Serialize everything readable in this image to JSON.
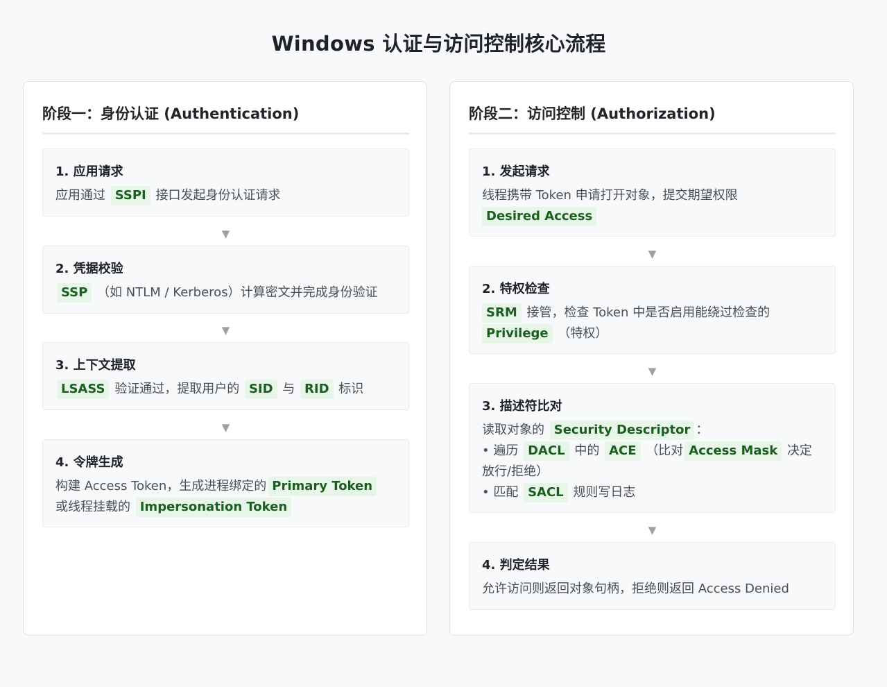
{
  "title": "Windows 认证与访问控制核心流程",
  "arrow_glyph": "▼",
  "phase1": {
    "title": "阶段一：身份认证 (Authentication)",
    "steps": [
      {
        "title": "1. 应用请求",
        "t1": "应用通过",
        "k1": "SSPI",
        "t2": "接口发起身份认证请求"
      },
      {
        "title": "2. 凭据校验",
        "k1": "SSP",
        "t1": "（如 NTLM / Kerberos）计算密文并完成身份验证"
      },
      {
        "title": "3. 上下文提取",
        "k1": "LSASS",
        "t1": "验证通过，提取用户的",
        "k2": "SID",
        "t2": "与",
        "k3": "RID",
        "t3": "标识"
      },
      {
        "title": "4. 令牌生成",
        "t1": "构建 Access Token，生成进程绑定的",
        "k1": "Primary Token",
        "t2": "或线程挂载的",
        "k2": "Impersonation Token"
      }
    ]
  },
  "phase2": {
    "title": "阶段二：访问控制 (Authorization)",
    "steps": [
      {
        "title": "1. 发起请求",
        "t1": "线程携带 Token 申请打开对象，提交期望权限",
        "k1": "Desired Access"
      },
      {
        "title": "2. 特权检查",
        "k1": "SRM",
        "t1": "接管，检查 Token 中是否启用能绕过检查的",
        "k2": "Privilege",
        "t2": "（特权）"
      },
      {
        "title": "3. 描述符比对",
        "t1": "读取对象的",
        "k1": "Security Descriptor",
        "t2": "：",
        "t3": "• 遍历",
        "k2": "DACL",
        "t4": "中的",
        "k3": "ACE",
        "t5": "（比对",
        "k4": "Access Mask",
        "t6": "决定放行/拒绝）",
        "t7": "• 匹配",
        "k5": "SACL",
        "t8": "规则写日志"
      },
      {
        "title": "4. 判定结果",
        "t1": "允许访问则返回对象句柄，拒绝则返回 Access Denied"
      }
    ]
  }
}
